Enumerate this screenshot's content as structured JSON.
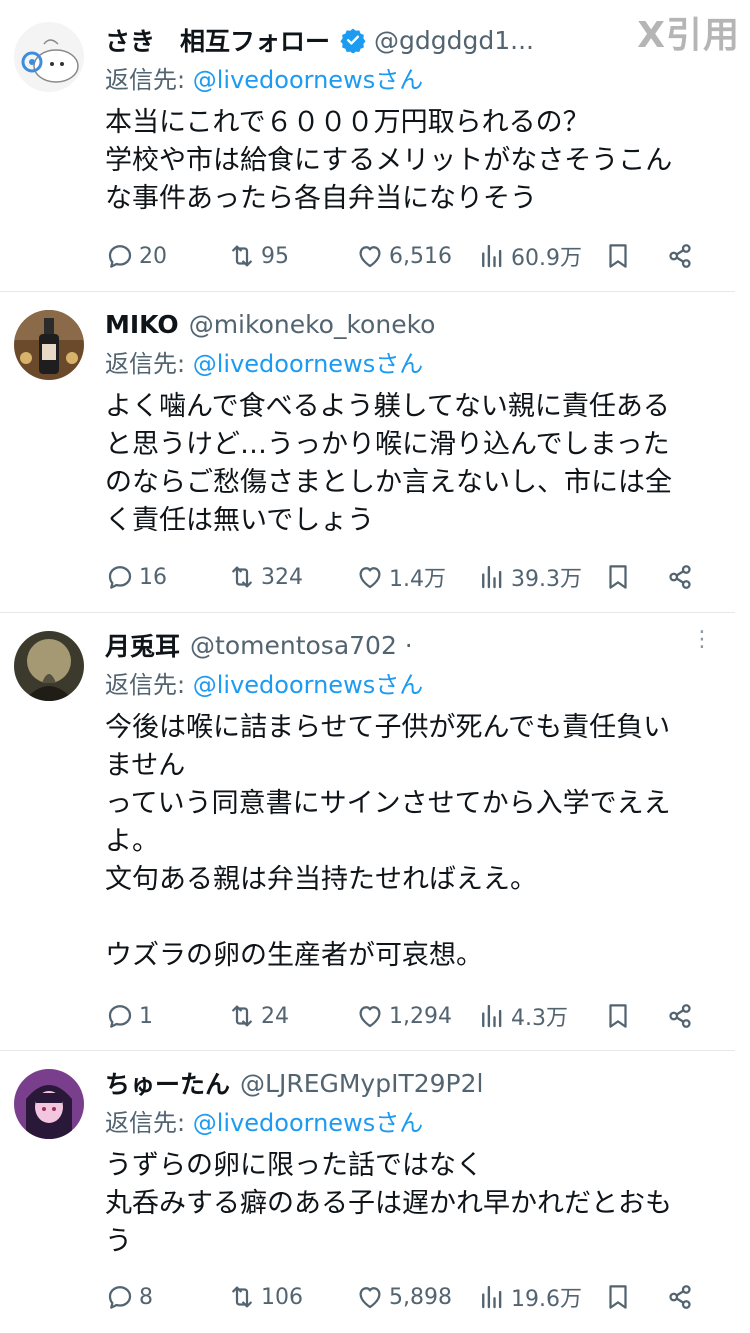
{
  "watermark": "X引用",
  "reply_prefix": "返信先:",
  "tweets": [
    {
      "name": "さき　相互フォロー",
      "verified": true,
      "handle": "@gdgdgd1...",
      "reply_to": "@livedoornewsさん",
      "text": "本当にこれで６０００万円取られるの？\n学校や市は給食にするメリットがなさそうこん\nな事件あったら各自弁当になりそう",
      "stats": {
        "replies": "20",
        "retweets": "95",
        "likes": "6,516",
        "views": "60.9万"
      },
      "avatar_colors": {
        "bg": "#f4f4f4",
        "fg": "#3d8ce0"
      }
    },
    {
      "name": "MIKO",
      "verified": false,
      "handle": "@mikoneko_koneko",
      "reply_to": "@livedoornewsさん",
      "text": "よく噛んで食べるよう躾してない親に責任ある\nと思うけど…うっかり喉に滑り込んでしまった\nのならご愁傷さまとしか言えないし、市には全\nく責任は無いでしょう",
      "stats": {
        "replies": "16",
        "retweets": "324",
        "likes": "1.4万",
        "views": "39.3万"
      },
      "avatar_colors": {
        "bg": "#6b4a2c",
        "fg": "#e8d9c6"
      }
    },
    {
      "name": "月兎耳",
      "verified": false,
      "handle": "@tomentosa702 ·",
      "reply_to": "@livedoornewsさん",
      "text": "今後は喉に詰まらせて子供が死んでも責任負い\nません\nっていう同意書にサインさせてから入学でええ\nよ。\n文句ある親は弁当持たせればええ。\n\nウズラの卵の生産者が可哀想。",
      "stats": {
        "replies": "1",
        "retweets": "24",
        "likes": "1,294",
        "views": "4.3万"
      },
      "avatar_colors": {
        "bg": "#3c3a2c",
        "fg": "#c7b98a"
      }
    },
    {
      "name": "ちゅーたん",
      "verified": false,
      "handle": "@LJREGMypIT29P2l",
      "reply_to": "@livedoornewsさん",
      "text": "うずらの卵に限った話ではなく\n丸呑みする癖のある子は遅かれ早かれだとおも\nう",
      "stats": {
        "replies": "8",
        "retweets": "106",
        "likes": "5,898",
        "views": "19.6万"
      },
      "avatar_colors": {
        "bg": "#7a3f8c",
        "fg": "#f3c6e0"
      }
    }
  ],
  "colors": {
    "text": "#0f1419",
    "muted": "#536471",
    "link": "#1d9bf0",
    "verified": "#1d9bf0"
  }
}
